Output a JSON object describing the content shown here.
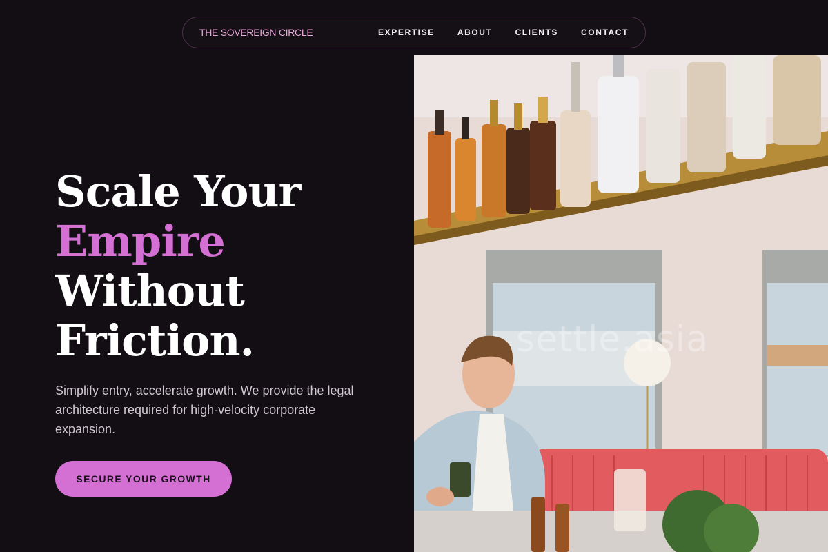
{
  "nav": {
    "brand": "THE SOVEREIGN CIRCLE",
    "links": [
      "EXPERTISE",
      "ABOUT",
      "CLIENTS",
      "CONTACT"
    ]
  },
  "hero": {
    "title_lines": [
      "Scale Your",
      "Empire",
      "Without",
      "Friction."
    ],
    "subtitle": "Simplify entry, accelerate growth. We provide the legal architecture required for high-velocity corporate expansion.",
    "cta_label": "SECURE YOUR GROWTH"
  },
  "photo": {
    "watermark": "settle.asia"
  },
  "colors": {
    "background": "#130e14",
    "accent": "#d46fd4",
    "brand": "#e8a8d8"
  }
}
